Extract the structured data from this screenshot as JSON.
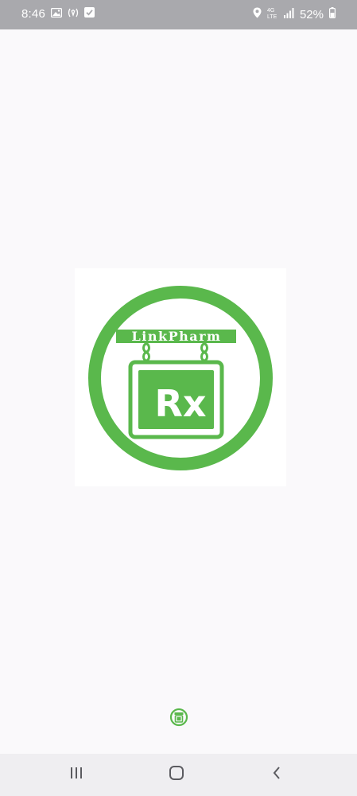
{
  "status_bar": {
    "time": "8:46",
    "battery_percent": "52%",
    "network_label_top": "4G",
    "network_label_bottom": "LTE"
  },
  "splash": {
    "logo_text": "LinkPharm",
    "sign_symbol": "Rx",
    "brand_color": "#5ab84c"
  },
  "nav_bar": {
    "recents_icon": "recents-icon",
    "home_icon": "home-icon",
    "back_icon": "back-icon"
  }
}
